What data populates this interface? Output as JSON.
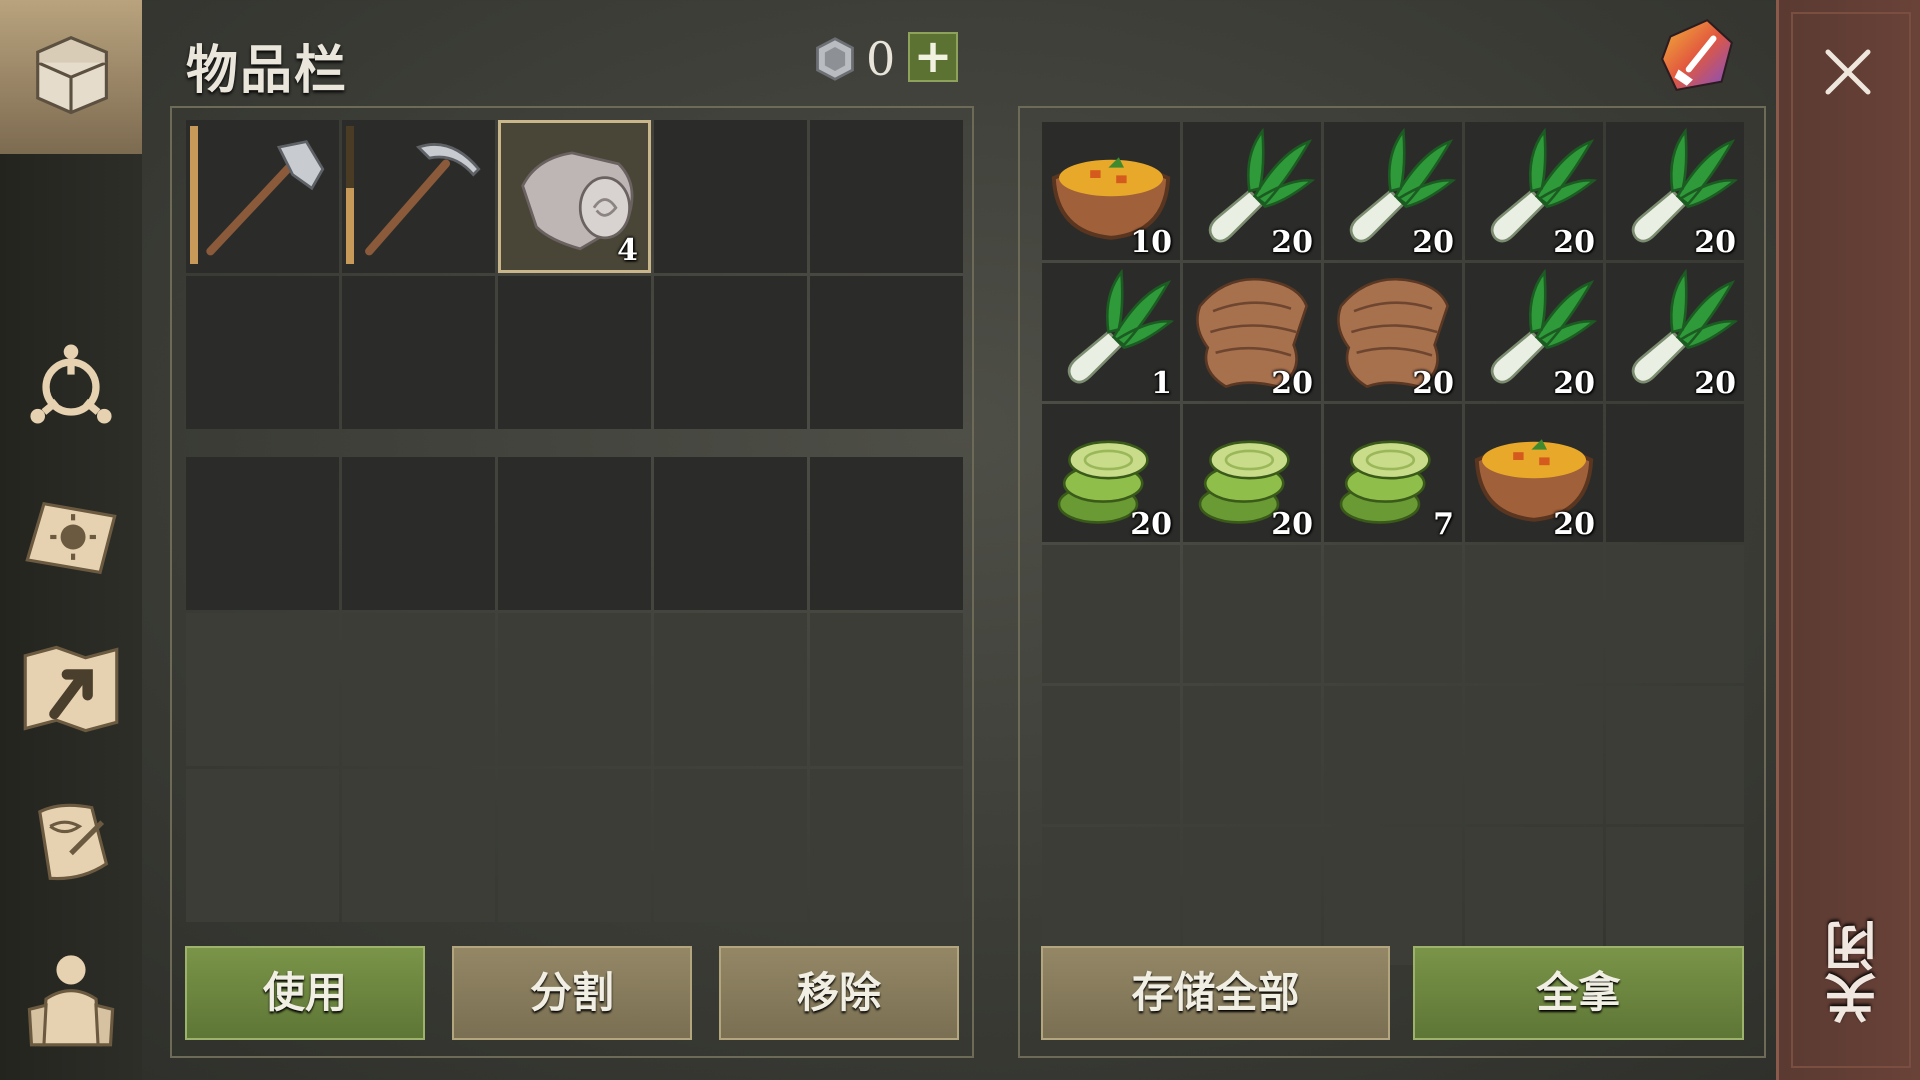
{
  "header": {
    "title": "物品栏",
    "currency_count": "0",
    "add_currency_label": "+"
  },
  "left_inventory": {
    "slots": [
      {
        "item": "axe-icon",
        "durability": 1.0,
        "count": ""
      },
      {
        "item": "pickaxe-icon",
        "durability": 0.55,
        "count": ""
      },
      {
        "item": "cloth-roll-icon",
        "count": "4",
        "selected": true
      },
      {
        "item": "",
        "count": ""
      },
      {
        "item": "",
        "count": ""
      },
      {
        "item": "",
        "count": ""
      },
      {
        "item": "",
        "count": ""
      },
      {
        "item": "",
        "count": ""
      },
      {
        "item": "",
        "count": ""
      },
      {
        "item": "",
        "count": ""
      }
    ]
  },
  "right_inventory": {
    "slots": [
      {
        "item": "soup-bowl-icon",
        "count": "10"
      },
      {
        "item": "leek-icon",
        "count": "20"
      },
      {
        "item": "leek-icon",
        "count": "20"
      },
      {
        "item": "leek-icon",
        "count": "20"
      },
      {
        "item": "leek-icon",
        "count": "20"
      },
      {
        "item": "leek-icon",
        "count": "1"
      },
      {
        "item": "rawhide-icon",
        "count": "20"
      },
      {
        "item": "rawhide-icon",
        "count": "20"
      },
      {
        "item": "leek-icon",
        "count": "20"
      },
      {
        "item": "leek-icon",
        "count": "20"
      },
      {
        "item": "cucumber-slices-icon",
        "count": "20"
      },
      {
        "item": "cucumber-slices-icon",
        "count": "20"
      },
      {
        "item": "cucumber-slices-icon",
        "count": "7"
      },
      {
        "item": "soup-bowl-icon",
        "count": "20"
      },
      {
        "item": "",
        "count": ""
      }
    ]
  },
  "buttons": {
    "use": "使用",
    "split": "分割",
    "remove": "移除",
    "store_all": "存储全部",
    "take_all": "全拿"
  },
  "close": {
    "label": "关闭"
  },
  "colors": {
    "accent_green": "#6b8540",
    "tan": "#887b5c",
    "close_bar": "#613e35"
  }
}
